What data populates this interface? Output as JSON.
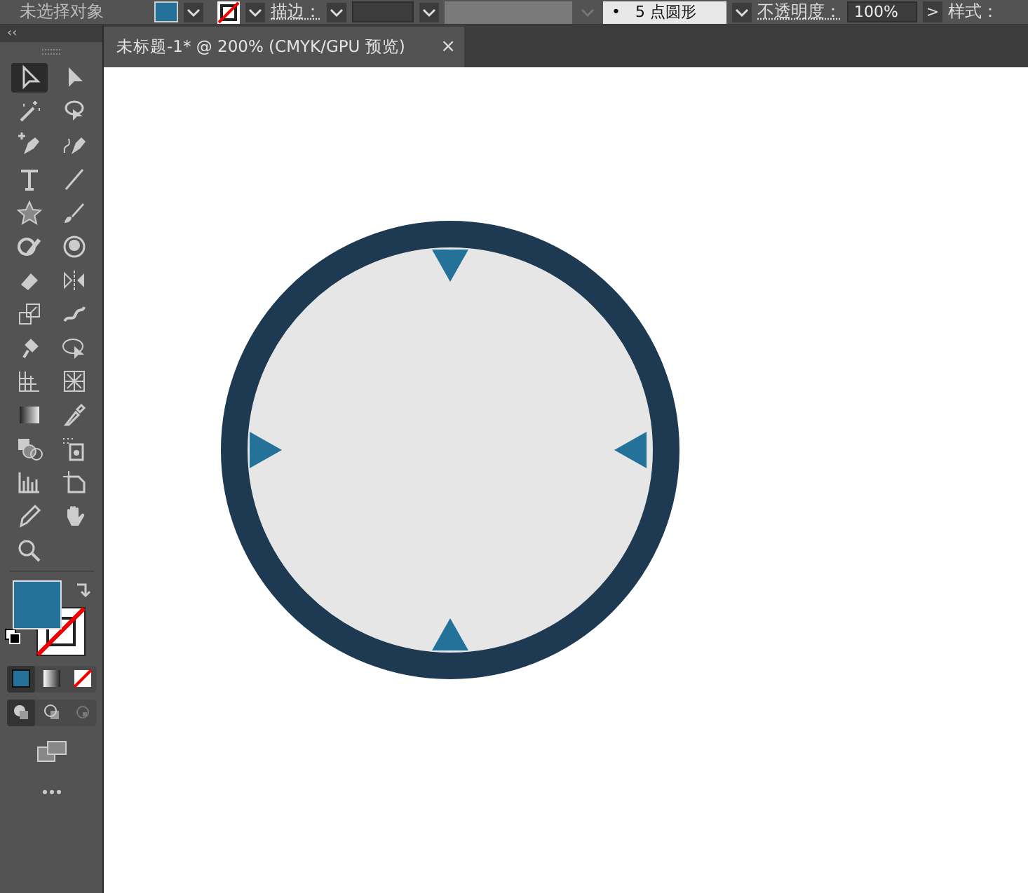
{
  "control_bar": {
    "selection_label": "未选择对象",
    "stroke_label": "描边：",
    "brush": {
      "dot": "•",
      "size": "5",
      "name": "点圆形"
    },
    "opacity_label": "不透明度：",
    "opacity_value": "100%",
    "more": ">",
    "style_label": "样式："
  },
  "document_tab": {
    "title": "未标题-1* @ 200% (CMYK/GPU 预览)",
    "close": "×"
  },
  "panel_collapse": "‹‹",
  "tools": [
    {
      "kind": "selection",
      "selected": true
    },
    {
      "kind": "direct-selection",
      "selected": false
    },
    {
      "kind": "magic-wand",
      "selected": false
    },
    {
      "kind": "lasso",
      "selected": false
    },
    {
      "kind": "pen",
      "selected": false
    },
    {
      "kind": "curvature",
      "selected": false
    },
    {
      "kind": "type",
      "selected": false
    },
    {
      "kind": "line",
      "selected": false
    },
    {
      "kind": "star",
      "selected": false
    },
    {
      "kind": "paintbrush",
      "selected": false
    },
    {
      "kind": "shaper",
      "selected": false
    },
    {
      "kind": "blob",
      "selected": false
    },
    {
      "kind": "eraser",
      "selected": false
    },
    {
      "kind": "reflect",
      "selected": false
    },
    {
      "kind": "scale",
      "selected": false
    },
    {
      "kind": "warp",
      "selected": false
    },
    {
      "kind": "pin",
      "selected": false
    },
    {
      "kind": "free-transform",
      "selected": false
    },
    {
      "kind": "mesh",
      "selected": false
    },
    {
      "kind": "perspective",
      "selected": false
    },
    {
      "kind": "gradient",
      "selected": false
    },
    {
      "kind": "eyedropper",
      "selected": false
    },
    {
      "kind": "shape-builder",
      "selected": false
    },
    {
      "kind": "sprayer",
      "selected": false
    },
    {
      "kind": "graph",
      "selected": false
    },
    {
      "kind": "artboard",
      "selected": false
    },
    {
      "kind": "pencil",
      "selected": false
    },
    {
      "kind": "hand",
      "selected": false
    },
    {
      "kind": "zoom",
      "selected": false
    }
  ],
  "color_modes": [
    {
      "kind": "color",
      "selected": true
    },
    {
      "kind": "gradient",
      "selected": false
    },
    {
      "kind": "none",
      "selected": false
    }
  ],
  "draw_modes": [
    {
      "kind": "normal",
      "selected": true
    },
    {
      "kind": "behind",
      "selected": false
    },
    {
      "kind": "inside",
      "selected": false
    }
  ]
}
